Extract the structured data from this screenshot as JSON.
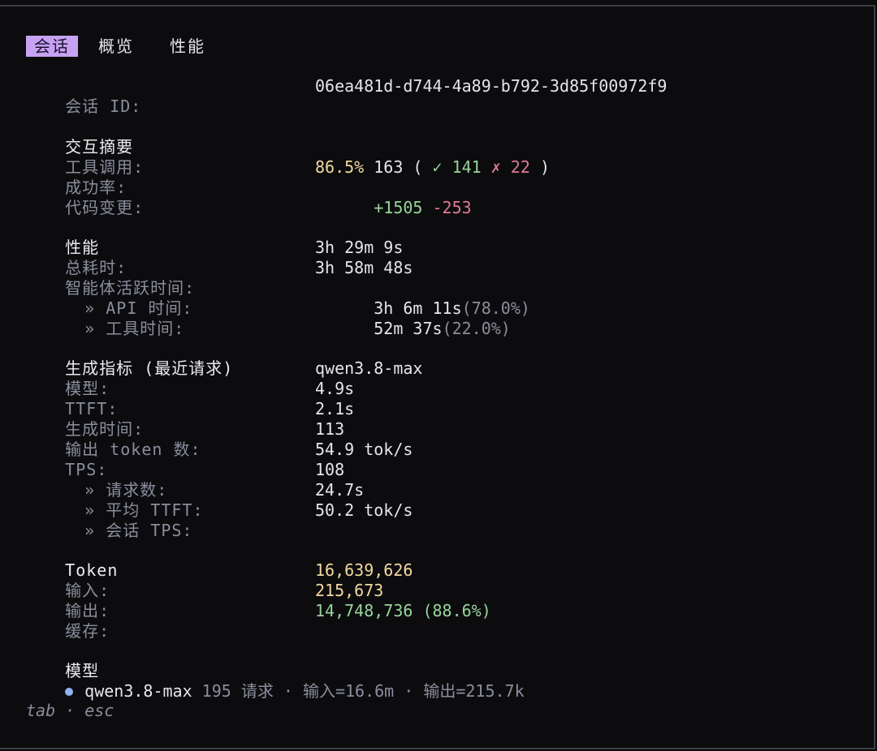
{
  "tabs": [
    "会话",
    "概览",
    "性能"
  ],
  "session": {
    "label": "会话 ID:",
    "value": "06ea481d-d744-4a89-b792-3d85f00972f9"
  },
  "interaction": {
    "title": "交互摘要",
    "tool_calls_label": "工具调用:",
    "tool_calls_total": "163",
    "tool_calls_open": "(",
    "tool_calls_success": "✓ 141",
    "tool_calls_fail": "✗ 22",
    "tool_calls_close": ")",
    "success_rate_label": "成功率:",
    "success_rate": "86.5%",
    "code_changes_label": "代码变更:",
    "lines_added": "+1505",
    "lines_removed": "-253"
  },
  "performance": {
    "title": "性能",
    "total_time_label": "总耗时:",
    "total_time": "3h 29m 9s",
    "agent_active_label": "智能体活跃时间:",
    "agent_active": "3h 58m 48s",
    "api_time_label": "» API 时间:",
    "api_time": "3h 6m 11s",
    "api_time_pct": "(78.0%)",
    "tool_time_label": "» 工具时间:",
    "tool_time": "52m 37s",
    "tool_time_pct": "(22.0%)"
  },
  "generation": {
    "title": "生成指标 (最近请求)",
    "model_label": "模型:",
    "model": "qwen3.8-max",
    "ttft_label": "TTFT:",
    "ttft": "4.9s",
    "gen_time_label": "生成时间:",
    "gen_time": "2.1s",
    "output_tokens_label": "输出 token 数:",
    "output_tokens": "113",
    "tps_label": "TPS:",
    "tps": "54.9 tok/s",
    "requests_label": "» 请求数:",
    "requests": "108",
    "avg_ttft_label": "» 平均 TTFT:",
    "avg_ttft": "24.7s",
    "session_tps_label": "» 会话 TPS:",
    "session_tps": "50.2 tok/s"
  },
  "tokens": {
    "title": "Token",
    "input_label": "输入:",
    "input": "16,639,626",
    "output_label": "输出:",
    "output": "215,673",
    "cache_label": "缓存:",
    "cache": "14,748,736 (88.6%)"
  },
  "models": {
    "title": "模型",
    "items": [
      {
        "name": "qwen3.8-max",
        "detail": "195 请求 · 输入=16.6m · 输出=215.7k"
      }
    ]
  },
  "footer": {
    "hint": "tab · esc"
  },
  "colors": {
    "accent": "#c7a2f2",
    "success": "#98d49a",
    "error": "#e27a97",
    "highlight": "#f2d8a0",
    "model_dot": "#8fb3f0"
  }
}
